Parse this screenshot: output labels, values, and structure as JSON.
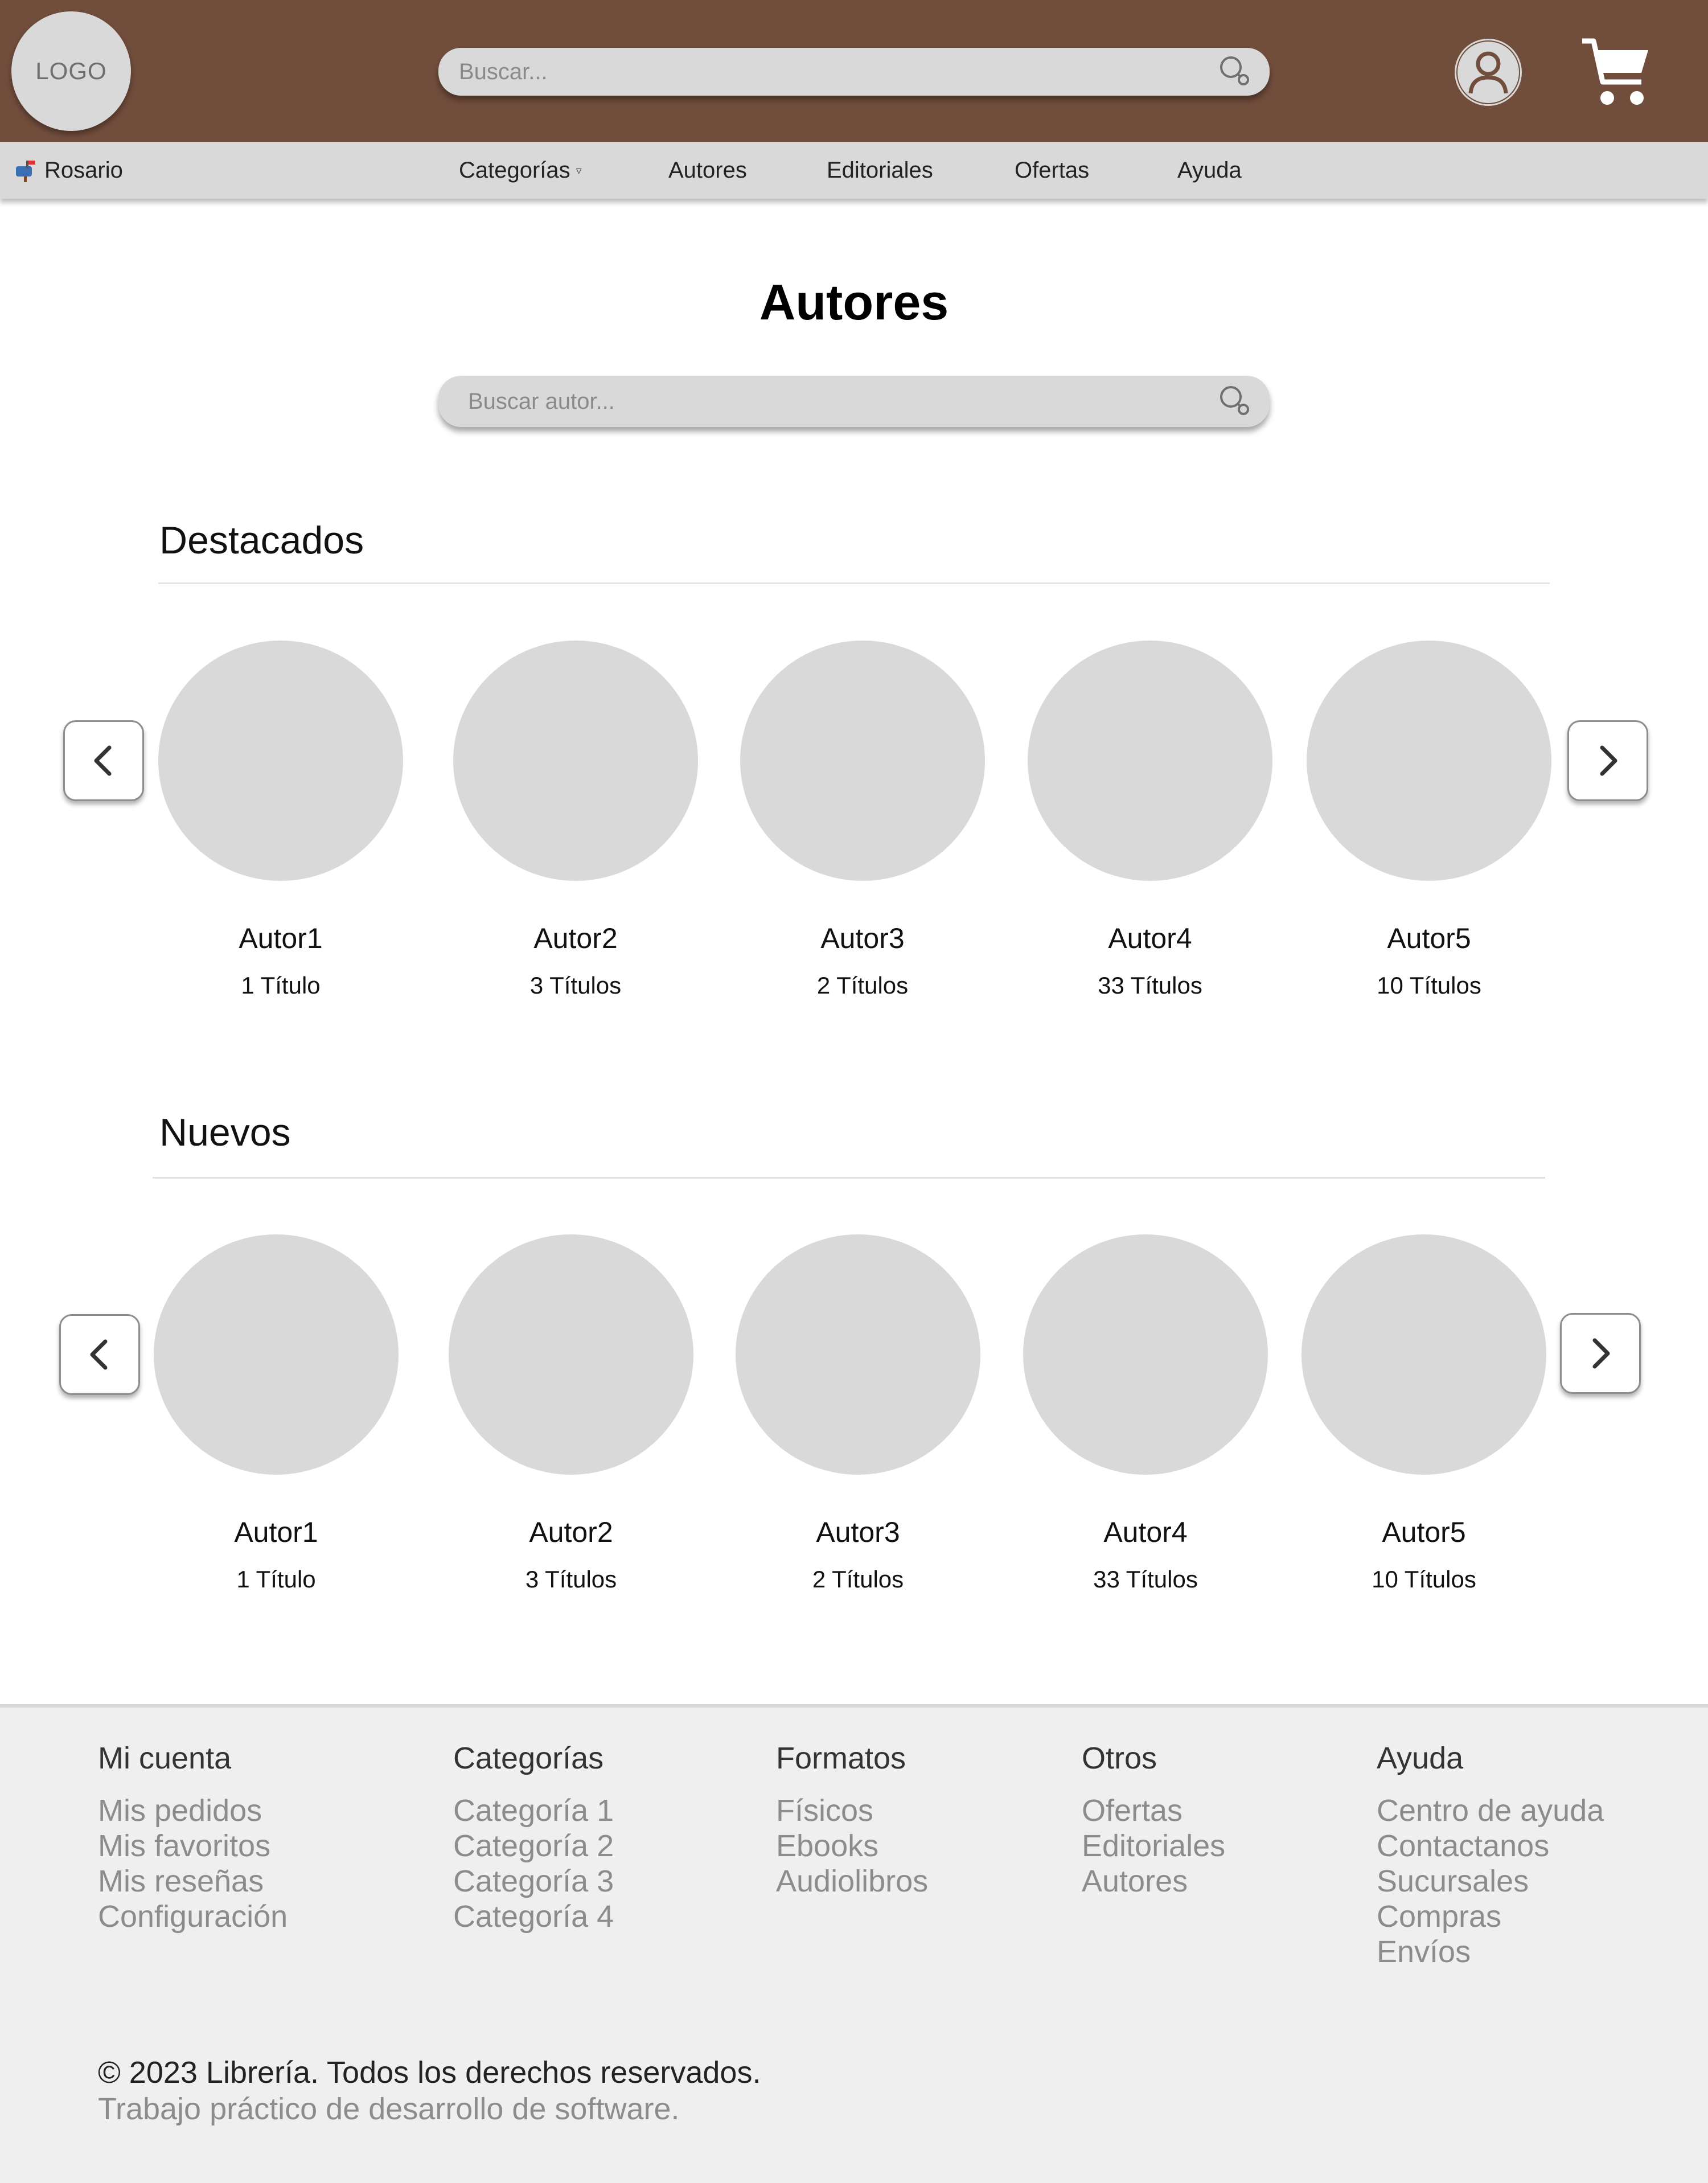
{
  "header": {
    "logo_text": "LOGO",
    "search_placeholder": "Buscar...",
    "icons": [
      "search-icon",
      "user-icon",
      "cart-icon"
    ]
  },
  "nav": {
    "location": "Rosario",
    "location_icon": "mailbox-icon",
    "items": [
      {
        "label": "Categorías",
        "has_dropdown": true
      },
      {
        "label": "Autores"
      },
      {
        "label": "Editoriales"
      },
      {
        "label": "Ofertas"
      },
      {
        "label": "Ayuda"
      }
    ]
  },
  "main": {
    "title": "Autores",
    "author_search_placeholder": "Buscar autor...",
    "sections": [
      {
        "title": "Destacados",
        "authors": [
          {
            "name": "Autor1",
            "count": "1 Título"
          },
          {
            "name": "Autor2",
            "count": "3 Títulos"
          },
          {
            "name": "Autor3",
            "count": "2 Títulos"
          },
          {
            "name": "Autor4",
            "count": "33 Títulos"
          },
          {
            "name": "Autor5",
            "count": "10 Títulos"
          }
        ]
      },
      {
        "title": "Nuevos",
        "authors": [
          {
            "name": "Autor1",
            "count": "1 Título"
          },
          {
            "name": "Autor2",
            "count": "3 Títulos"
          },
          {
            "name": "Autor3",
            "count": "2 Títulos"
          },
          {
            "name": "Autor4",
            "count": "33 Títulos"
          },
          {
            "name": "Autor5",
            "count": "10 Títulos"
          }
        ]
      }
    ]
  },
  "footer": {
    "columns": [
      {
        "heading": "Mi cuenta",
        "links": [
          "Mis pedidos",
          "Mis favoritos",
          "Mis reseñas",
          "Configuración"
        ]
      },
      {
        "heading": "Categorías",
        "links": [
          "Categoría 1",
          "Categoría 2",
          "Categoría 3",
          "Categoría 4"
        ]
      },
      {
        "heading": "Formatos",
        "links": [
          "Físicos",
          "Ebooks",
          "Audiolibros"
        ]
      },
      {
        "heading": "Otros",
        "links": [
          "Ofertas",
          "Editoriales",
          "Autores"
        ]
      },
      {
        "heading": "Ayuda",
        "links": [
          "Centro de ayuda",
          "Contactanos",
          "Sucursales",
          "Compras",
          "Envíos"
        ]
      }
    ],
    "copyright": "© 2023 Librería. Todos los derechos reservados.",
    "subtitle": "Trabajo práctico de desarrollo de software."
  },
  "colors": {
    "header_bg": "#714d3c",
    "nav_bg": "#d9d9d9",
    "placeholder_gray": "#d9d9d9",
    "footer_bg": "#efefef"
  }
}
